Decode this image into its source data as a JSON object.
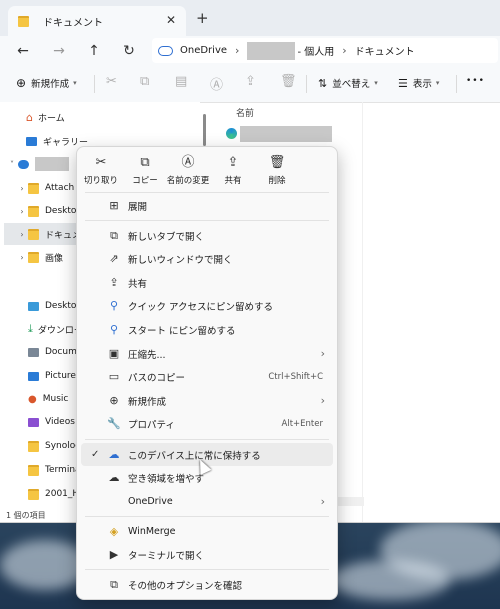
{
  "window": {
    "tab_title": "ドキュメント",
    "close_glyph": "✕",
    "newtab_glyph": "+"
  },
  "address": {
    "root": "OneDrive",
    "owner_suffix": "- 個人用",
    "folder": "ドキュメント",
    "separator": "›"
  },
  "toolbar": {
    "new_label": "新規作成",
    "sort_label": "並べ替え",
    "view_label": "表示",
    "more": "•••"
  },
  "nav": {
    "items": [
      {
        "label": "ホーム",
        "icon": "home-icon"
      },
      {
        "label": "ギャラリー",
        "icon": "gallery-icon"
      },
      {
        "label": "Attach"
      },
      {
        "label": "Deskto"
      },
      {
        "label": "ドキュメ"
      },
      {
        "label": "画像"
      },
      {
        "label": "Desktop"
      },
      {
        "label": "ダウンロー"
      },
      {
        "label": "Docume"
      },
      {
        "label": "Pictures"
      },
      {
        "label": "Music"
      },
      {
        "label": "Videos"
      },
      {
        "label": "Synolog"
      },
      {
        "label": "Termina"
      },
      {
        "label": "2001_H1"
      }
    ],
    "status": "1 個の項目"
  },
  "content": {
    "column_name": "名前"
  },
  "menu": {
    "quick": {
      "cut": "切り取り",
      "copy": "コピー",
      "rename": "名前の変更",
      "share": "共有",
      "delete": "削除"
    },
    "items": [
      {
        "label": "展開"
      },
      {
        "label": "新しいタブで開く"
      },
      {
        "label": "新しいウィンドウで開く"
      },
      {
        "label": "共有"
      },
      {
        "label": "クイック アクセスにピン留めする"
      },
      {
        "label": "スタート にピン留めする"
      },
      {
        "label": "圧縮先..."
      },
      {
        "label": "パスのコピー",
        "shortcut": "Ctrl+Shift+C"
      },
      {
        "label": "新規作成"
      },
      {
        "label": "プロパティ",
        "shortcut": "Alt+Enter"
      },
      {
        "label": "このデバイス上に常に保持する"
      },
      {
        "label": "空き領域を増やす"
      },
      {
        "label": "OneDrive"
      },
      {
        "label": "WinMerge"
      },
      {
        "label": "ターミナルで開く"
      },
      {
        "label": "その他のオプションを確認"
      }
    ]
  }
}
